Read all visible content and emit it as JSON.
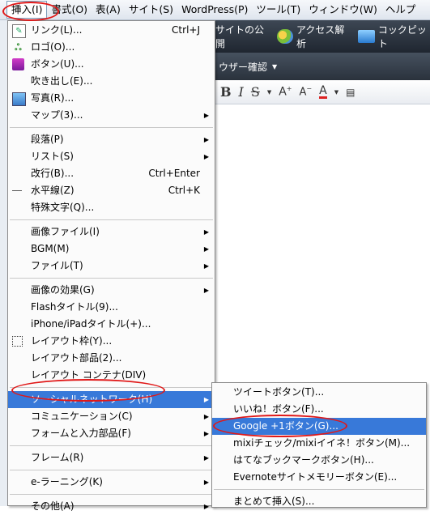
{
  "menubar": {
    "items": [
      "挿入(I)",
      "書式(O)",
      "表(A)",
      "サイト(S)",
      "WordPress(P)",
      "ツール(T)",
      "ウィンドウ(W)",
      "ヘルプ"
    ]
  },
  "toolbar": {
    "publish": "サイトの公開",
    "analytics": "アクセス解析",
    "cockpit": "コックピット",
    "user_check": "ウザー確認"
  },
  "format_buttons": [
    "B",
    "I",
    "S"
  ],
  "main_menu": {
    "group1": [
      {
        "label": "リンク(L)...",
        "shortcut": "Ctrl+J",
        "icon": "link-icon"
      },
      {
        "label": "ロゴ(O)...",
        "icon": "logo-icon"
      },
      {
        "label": "ボタン(U)...",
        "icon": "button-icon"
      },
      {
        "label": "吹き出し(E)..."
      },
      {
        "label": "写真(R)...",
        "icon": "photo-icon"
      },
      {
        "label": "マップ(3)...",
        "submenu": true
      }
    ],
    "group2": [
      {
        "label": "段落(P)",
        "submenu": true
      },
      {
        "label": "リスト(S)",
        "submenu": true
      },
      {
        "label": "改行(B)...",
        "shortcut": "Ctrl+Enter"
      },
      {
        "label": "水平線(Z)",
        "shortcut": "Ctrl+K",
        "icon": "horizontal-line-icon"
      },
      {
        "label": "特殊文字(Q)..."
      }
    ],
    "group3": [
      {
        "label": "画像ファイル(I)",
        "submenu": true
      },
      {
        "label": "BGM(M)",
        "submenu": true
      },
      {
        "label": "ファイル(T)",
        "submenu": true
      }
    ],
    "group4": [
      {
        "label": "画像の効果(G)",
        "submenu": true
      },
      {
        "label": "Flashタイトル(9)..."
      },
      {
        "label": "iPhone/iPadタイトル(+)..."
      },
      {
        "label": "レイアウト枠(Y)...",
        "icon": "layout-frame-icon"
      },
      {
        "label": "レイアウト部品(2)..."
      },
      {
        "label": "レイアウト コンテナ(DIV)"
      }
    ],
    "group5": [
      {
        "label": "ソーシャルネットワーク(H)",
        "submenu": true,
        "highlighted": true
      },
      {
        "label": "コミュニケーション(C)",
        "submenu": true
      },
      {
        "label": "フォームと入力部品(F)",
        "submenu": true
      }
    ],
    "group6": [
      {
        "label": "フレーム(R)",
        "submenu": true
      }
    ],
    "group7": [
      {
        "label": "e-ラーニング(K)",
        "submenu": true
      }
    ],
    "group8": [
      {
        "label": "その他(A)",
        "submenu": true
      }
    ]
  },
  "sub_menu": {
    "group1": [
      {
        "label": "ツイートボタン(T)..."
      },
      {
        "label": "いいね！ボタン(F)..."
      },
      {
        "label": "Google +1ボタン(G)...",
        "highlighted": true
      },
      {
        "label": "mixiチェック/mixiイイネ！ボタン(M)..."
      },
      {
        "label": "はてなブックマークボタン(H)..."
      },
      {
        "label": "Evernoteサイトメモリーボタン(E)..."
      }
    ],
    "group2": [
      {
        "label": "まとめて挿入(S)..."
      }
    ]
  },
  "colors": {
    "highlight": "#3879d9",
    "annotation": "#e01818"
  }
}
